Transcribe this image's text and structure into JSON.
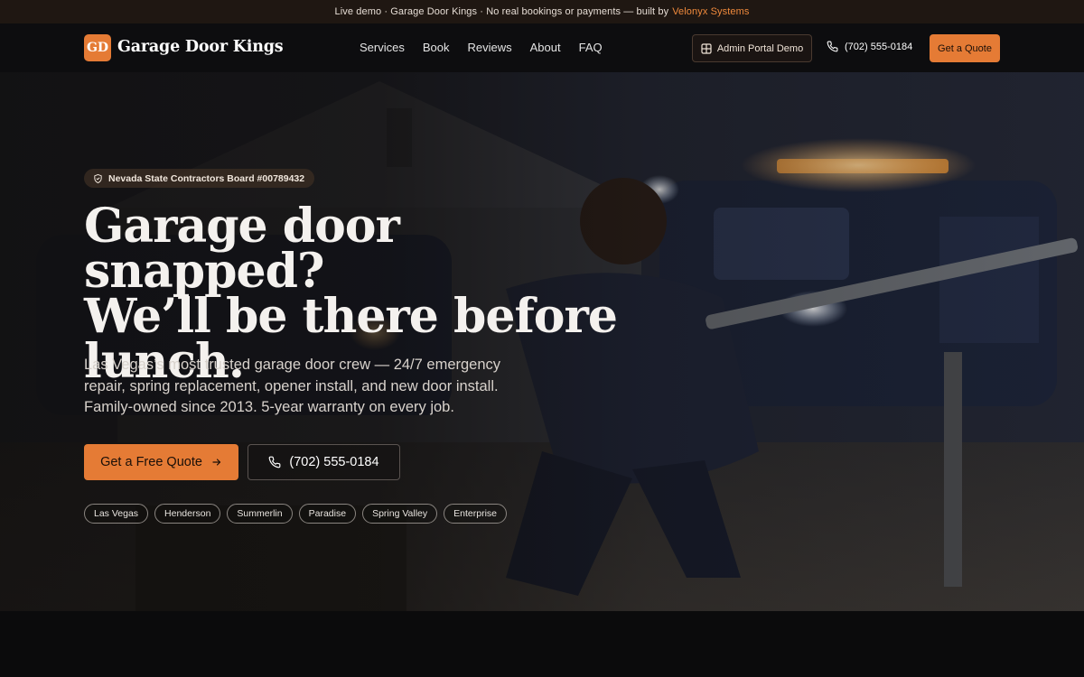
{
  "banner": {
    "text": "Live demo · Garage Door Kings · No real bookings or payments — built by",
    "builder": "Velonyx Systems"
  },
  "header": {
    "logo_mark": "GD",
    "brand_name": "Garage Door Kings",
    "nav": [
      "Services",
      "Book",
      "Reviews",
      "About",
      "FAQ"
    ],
    "admin_button": "Admin Portal Demo",
    "admin_icon": "grid-icon",
    "phone": "(702) 555-0184",
    "phone_icon": "phone-icon",
    "quote_button": "Get a Quote"
  },
  "hero": {
    "license_badge": "Nevada State Contractors Board #00789432",
    "license_icon": "shield-check-icon",
    "headline_line1": "Garage door snapped?",
    "headline_line2": "We’ll be there before",
    "headline_line3": "lunch.",
    "subcopy": "Las Vegas’s most trusted garage door crew — 24/7 emergency repair, spring replacement, opener install, and new door install. Family-owned since 2013. 5-year warranty on every job.",
    "cta_primary": "Get a Free Quote",
    "cta_primary_icon": "arrow-right-icon",
    "cta_phone": "(702) 555-0184",
    "service_areas": [
      "Las Vegas",
      "Henderson",
      "Summerlin",
      "Paradise",
      "Spring Valley",
      "Enterprise"
    ]
  },
  "colors": {
    "accent": "#e57b35",
    "banner_bg": "#1f1712",
    "nav_bg": "#0d0d0f"
  }
}
